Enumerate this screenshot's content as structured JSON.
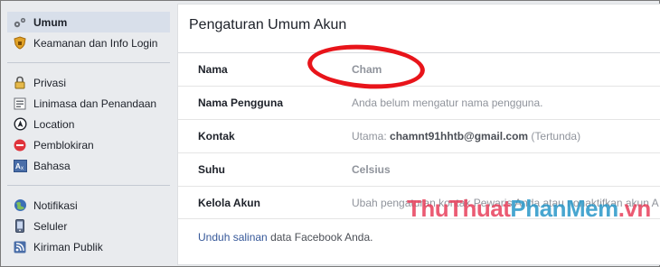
{
  "sidebar": {
    "group1": [
      {
        "label": "Umum",
        "icon": "gear-icon",
        "active": true
      },
      {
        "label": "Keamanan dan Info Login",
        "icon": "shield-icon"
      }
    ],
    "group2": [
      {
        "label": "Privasi",
        "icon": "lock-icon"
      },
      {
        "label": "Linimasa dan Penandaan",
        "icon": "timeline-icon"
      },
      {
        "label": "Location",
        "icon": "location-icon"
      },
      {
        "label": "Pemblokiran",
        "icon": "block-icon"
      },
      {
        "label": "Bahasa",
        "icon": "language-icon"
      }
    ],
    "group3": [
      {
        "label": "Notifikasi",
        "icon": "globe-icon"
      },
      {
        "label": "Seluler",
        "icon": "mobile-icon"
      },
      {
        "label": "Kiriman Publik",
        "icon": "rss-icon"
      }
    ]
  },
  "panel": {
    "title": "Pengaturan Umum Akun",
    "rows": [
      {
        "label": "Nama",
        "value": "Cham"
      },
      {
        "label": "Nama Pengguna",
        "value": "Anda belum mengatur nama pengguna."
      },
      {
        "label": "Kontak",
        "value_prefix": "Utama: ",
        "value_bold": "chamnt91hhtb@gmail.com",
        "value_suffix": " (Tertunda)"
      },
      {
        "label": "Suhu",
        "value": "Celsius"
      },
      {
        "label": "Kelola Akun",
        "value": "Ubah pengaturan kontak Pewaris Anda atau nonaktifkan akun A"
      }
    ],
    "footer_link": "Unduh salinan",
    "footer_text": " data Facebook Anda."
  },
  "watermark": {
    "part1": "ThuThuat",
    "part2": "PhanMem",
    "part3": ".vn"
  },
  "colors": {
    "active_bg": "#d8dfea",
    "link": "#365899",
    "annotation_red": "#e8141a"
  }
}
